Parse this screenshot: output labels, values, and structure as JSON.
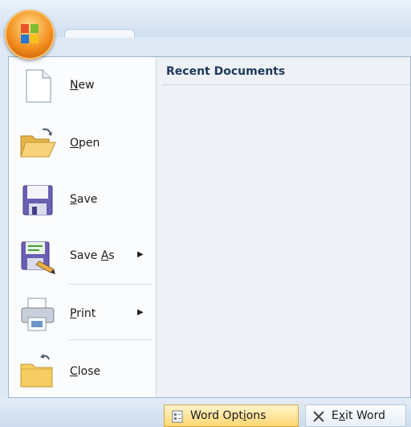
{
  "menu": {
    "items": [
      {
        "name": "new",
        "pre": "",
        "key": "N",
        "post": "ew",
        "has_submenu": false
      },
      {
        "name": "open",
        "pre": "",
        "key": "O",
        "post": "pen",
        "has_submenu": false
      },
      {
        "name": "save",
        "pre": "",
        "key": "S",
        "post": "ave",
        "has_submenu": false
      },
      {
        "name": "save-as",
        "pre": "Save ",
        "key": "A",
        "post": "s",
        "has_submenu": true
      },
      {
        "name": "print",
        "pre": "",
        "key": "P",
        "post": "rint",
        "has_submenu": true
      },
      {
        "name": "close",
        "pre": "",
        "key": "C",
        "post": "lose",
        "has_submenu": false
      }
    ],
    "recent_title": "Recent Documents",
    "submenu_arrow": "▶"
  },
  "footer": {
    "options": {
      "pre": "Word Opt",
      "key": "i",
      "post": "ons",
      "icon": "options-icon"
    },
    "exit": {
      "pre": "E",
      "key": "x",
      "post": "it Word",
      "icon": "close-x-icon"
    }
  },
  "colors": {
    "recent_title": "#1e395b",
    "options_button": "#ffd772",
    "office_button": "#f28b1c"
  }
}
